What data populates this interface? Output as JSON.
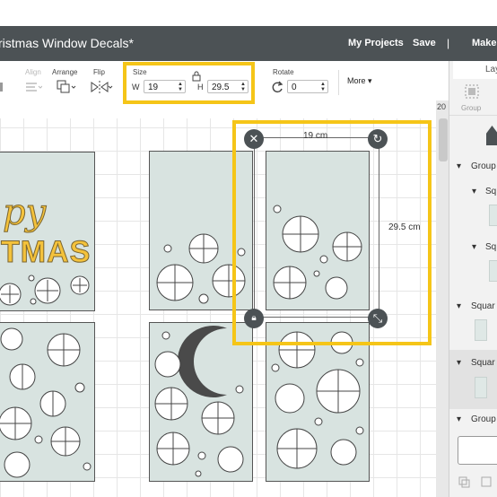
{
  "header": {
    "title": "ristmas Window Decals*",
    "my_projects": "My Projects",
    "save": "Save",
    "separator": "|",
    "make": "Make"
  },
  "toolbar": {
    "align_label": "Align",
    "arrange_label": "Arrange",
    "flip_label": "Flip",
    "size_label": "Size",
    "w_label": "W",
    "w_value": "19",
    "h_label": "H",
    "h_value": "29.5",
    "rotate_label": "Rotate",
    "rotate_value": "0",
    "more_label": "More"
  },
  "ruler": {
    "corner_value": "20"
  },
  "layers_panel": {
    "tab_label": "Lay",
    "group_label": "Group",
    "items": [
      {
        "label": "Group",
        "caret": "▾"
      },
      {
        "label": "Sq",
        "caret": "▾"
      },
      {
        "label": "Sq",
        "caret": "▾"
      },
      {
        "label": "Squar",
        "caret": "▾"
      },
      {
        "label": "Squar",
        "caret": "▾"
      },
      {
        "label": "Group",
        "caret": "▾"
      }
    ]
  },
  "canvas": {
    "selection_width": "19 cm",
    "selection_height": "29.5 cm",
    "decal_text_line1": "py",
    "decal_text_line2": "TMAS"
  },
  "colors": {
    "highlight": "#f5c518",
    "header_bg": "#4c5255",
    "decal_fill": "#d8e3e0",
    "text_gold": "#f4c23b",
    "moon": "#4a4a4a"
  }
}
